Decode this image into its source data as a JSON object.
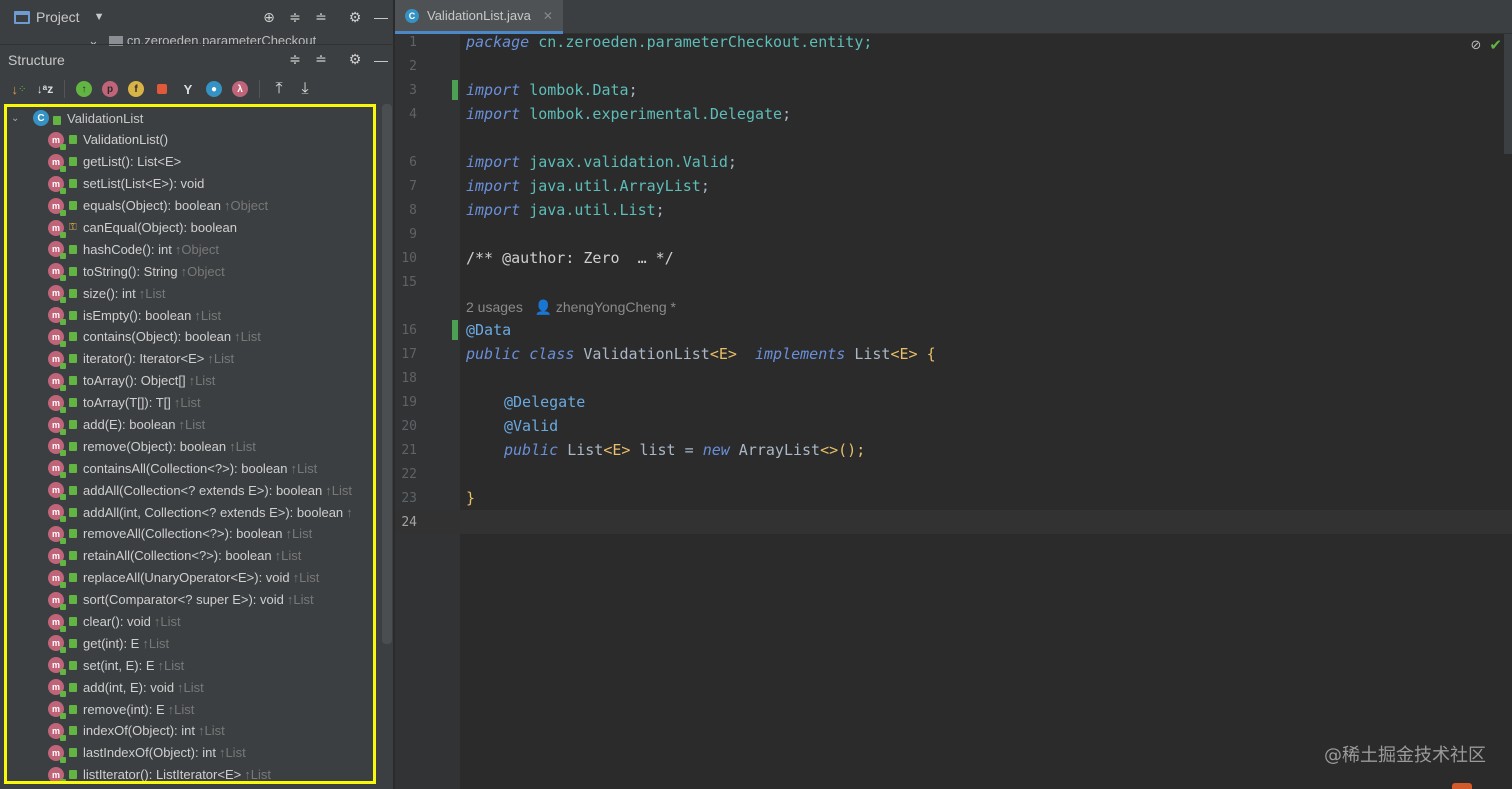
{
  "project_panel": {
    "title": "Project",
    "peek_text": "cn.zeroeden.parameterCheckout"
  },
  "structure_panel": {
    "title": "Structure",
    "root_class": "ValidationList",
    "members": [
      {
        "name": "ValidationList()",
        "inherited": ""
      },
      {
        "name": "getList(): List<E>",
        "inherited": ""
      },
      {
        "name": "setList(List<E>): void",
        "inherited": ""
      },
      {
        "name": "equals(Object): boolean",
        "inherited": "↑Object"
      },
      {
        "name": "canEqual(Object): boolean",
        "inherited": "",
        "access": "protected"
      },
      {
        "name": "hashCode(): int",
        "inherited": "↑Object"
      },
      {
        "name": "toString(): String",
        "inherited": "↑Object"
      },
      {
        "name": "size(): int",
        "inherited": "↑List"
      },
      {
        "name": "isEmpty(): boolean",
        "inherited": "↑List"
      },
      {
        "name": "contains(Object): boolean",
        "inherited": "↑List"
      },
      {
        "name": "iterator(): Iterator<E>",
        "inherited": "↑List"
      },
      {
        "name": "toArray(): Object[]",
        "inherited": "↑List"
      },
      {
        "name": "toArray(T[]): T[]",
        "inherited": "↑List"
      },
      {
        "name": "add(E): boolean",
        "inherited": "↑List"
      },
      {
        "name": "remove(Object): boolean",
        "inherited": "↑List"
      },
      {
        "name": "containsAll(Collection<?>): boolean",
        "inherited": "↑List"
      },
      {
        "name": "addAll(Collection<? extends E>): boolean",
        "inherited": "↑List"
      },
      {
        "name": "addAll(int, Collection<? extends E>): boolean",
        "inherited": "↑"
      },
      {
        "name": "removeAll(Collection<?>): boolean",
        "inherited": "↑List"
      },
      {
        "name": "retainAll(Collection<?>): boolean",
        "inherited": "↑List"
      },
      {
        "name": "replaceAll(UnaryOperator<E>): void",
        "inherited": "↑List"
      },
      {
        "name": "sort(Comparator<? super E>): void",
        "inherited": "↑List"
      },
      {
        "name": "clear(): void",
        "inherited": "↑List"
      },
      {
        "name": "get(int): E",
        "inherited": "↑List"
      },
      {
        "name": "set(int, E): E",
        "inherited": "↑List"
      },
      {
        "name": "add(int, E): void",
        "inherited": "↑List"
      },
      {
        "name": "remove(int): E",
        "inherited": "↑List"
      },
      {
        "name": "indexOf(Object): int",
        "inherited": "↑List"
      },
      {
        "name": "lastIndexOf(Object): int",
        "inherited": "↑List"
      },
      {
        "name": "listIterator(): ListIterator<E>",
        "inherited": "↑List"
      }
    ]
  },
  "editor": {
    "tab_title": "ValidationList.java",
    "line_numbers": [
      "1",
      "2",
      "3",
      "4",
      "6",
      "7",
      "8",
      "9",
      "10",
      "15",
      "16",
      "17",
      "18",
      "19",
      "20",
      "21",
      "22",
      "23",
      "24"
    ],
    "inlay": {
      "usages": "2 usages",
      "author": "zhengYongCheng *"
    },
    "code": {
      "l1_kw": "package",
      "l1_rest": " cn.zeroeden.parameterCheckout.entity;",
      "l3_kw": "import",
      "l3_pkg": " lombok.",
      "l3_cls": "Data",
      "l3_end": ";",
      "l4_kw": "import",
      "l4_pkg": " lombok.experimental.",
      "l4_cls": "Delegate",
      "l4_end": ";",
      "l6_kw": "import",
      "l6_pkg": " javax.validation.",
      "l6_cls": "Valid",
      "l6_end": ";",
      "l7_kw": "import",
      "l7_pkg": " java.util.",
      "l7_cls": "ArrayList",
      "l7_end": ";",
      "l8_kw": "import",
      "l8_pkg": " java.util.",
      "l8_cls": "List",
      "l8_end": ";",
      "l10": "/** @author: Zero  … */",
      "l16": "@Data",
      "l17_a": "public class",
      "l17_b": " ValidationList",
      "l17_c": "<E>",
      "l17_d": "  implements",
      "l17_e": " List",
      "l17_f": "<E>",
      "l17_g": " {",
      "l19": "@Delegate",
      "l20": "@Valid",
      "l21_a": "public",
      "l21_b": " List",
      "l21_c": "<E>",
      "l21_d": " list = ",
      "l21_e": "new",
      "l21_f": " ArrayList",
      "l21_g": "<>",
      "l21_h": "();",
      "l23": "}"
    }
  },
  "watermark": "@稀土掘金技术社区"
}
